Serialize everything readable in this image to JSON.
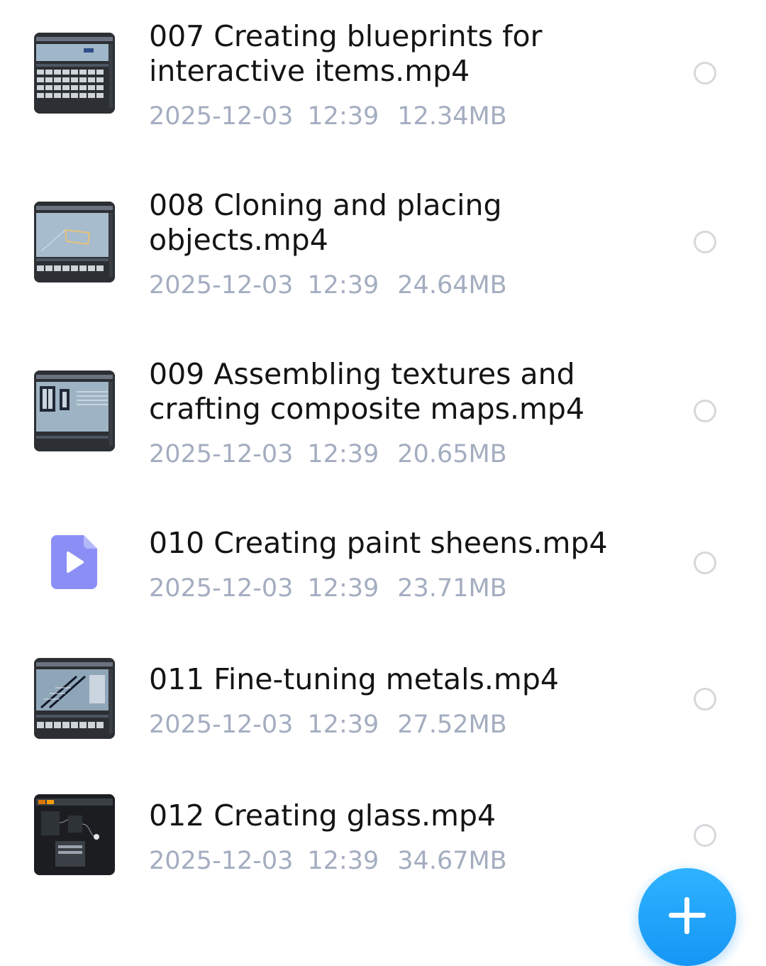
{
  "files": [
    {
      "name": "007 Creating blueprints for\ninteractive items.mp4",
      "date": "2025-12-03",
      "time": "12:39",
      "size": "12.34MB",
      "thumb_icon": "video-thumbnail-icon"
    },
    {
      "name": "008 Cloning and placing\nobjects.mp4",
      "date": "2025-12-03",
      "time": "12:39",
      "size": "24.64MB",
      "thumb_icon": "video-thumbnail-icon"
    },
    {
      "name": "009 Assembling textures and\ncrafting composite maps.mp4",
      "date": "2025-12-03",
      "time": "12:39",
      "size": "20.65MB",
      "thumb_icon": "video-thumbnail-icon"
    },
    {
      "name": "010 Creating paint sheens.mp4",
      "date": "2025-12-03",
      "time": "12:39",
      "size": "23.71MB",
      "thumb_icon": "video-file-icon"
    },
    {
      "name": "011 Fine-tuning metals.mp4",
      "date": "2025-12-03",
      "time": "12:39",
      "size": "27.52MB",
      "thumb_icon": "video-thumbnail-icon"
    },
    {
      "name": "012 Creating glass.mp4",
      "date": "2025-12-03",
      "time": "12:39",
      "size": "34.67MB",
      "thumb_icon": "video-thumbnail-icon",
      "thumb_watermark": "MATER"
    }
  ],
  "fab": {
    "icon": "plus-icon",
    "color": "#1a9cf7"
  },
  "colors": {
    "title": "#141414",
    "meta": "#a4adc0",
    "radio_border": "#d6d8dc",
    "video_icon": "#8b8ff5"
  }
}
